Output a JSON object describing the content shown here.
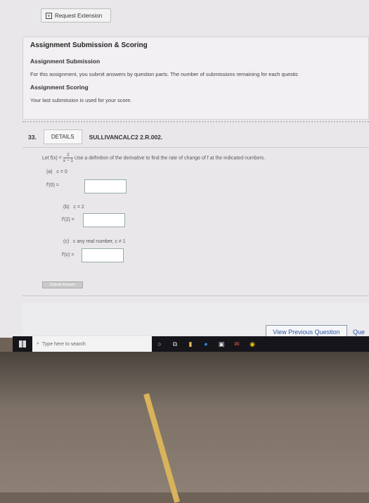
{
  "request_extension": {
    "label": "Request Extension"
  },
  "policies": {
    "title": "Assignment Submission & Scoring",
    "submission_heading": "Assignment Submission",
    "submission_text": "For this assignment, you submit answers by question parts. The number of submissions remaining for each questic",
    "scoring_heading": "Assignment Scoring",
    "scoring_text": "Your last submission is used for your score."
  },
  "question": {
    "number": "33.",
    "details_label": "DETAILS",
    "code": "SULLIVANCALC2 2.R.002.",
    "prompt_prefix": "Let f(x) =",
    "fraction_num": "2",
    "fraction_den": "x − 1",
    "prompt_suffix": "Use a definition of the derivative to find the rate of change of f at the indicated numbers.",
    "parts": [
      {
        "label": "(a)",
        "condition": "c = 0",
        "answer_label": "f′(0) =",
        "value": ""
      },
      {
        "label": "(b)",
        "condition": "c = 2",
        "answer_label": "f′(2) =",
        "value": ""
      },
      {
        "label": "(c)",
        "condition": "c any real number, c ≠ 1",
        "answer_label": "f′(c) =",
        "value": ""
      }
    ],
    "submit_label": "Submit Answer"
  },
  "navigation": {
    "prev_label": "View Previous Question",
    "next_label_fragment": "Que"
  },
  "taskbar": {
    "search_placeholder": "Type here to search"
  },
  "colors": {
    "link_blue": "#2b55a8",
    "taskbar": "#15151a"
  }
}
